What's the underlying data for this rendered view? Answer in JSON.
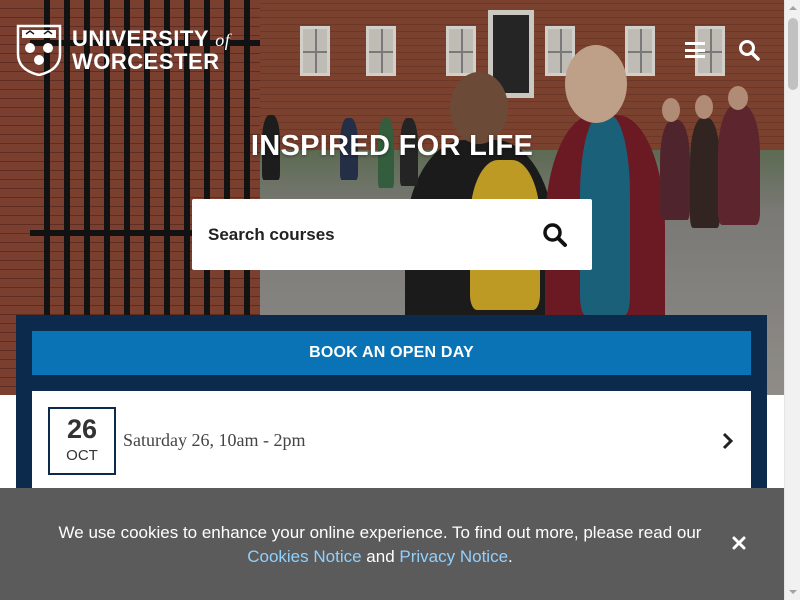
{
  "header": {
    "logo_line1": "UNIVERSITY",
    "logo_of": "of",
    "logo_line2": "WORCESTER",
    "menu_icon": "hamburger-menu-icon",
    "search_icon": "search-icon"
  },
  "hero": {
    "headline": "INSPIRED FOR LIFE",
    "search_placeholder": "Search courses"
  },
  "open_day": {
    "button_label": "BOOK AN OPEN DAY",
    "event": {
      "day": "26",
      "month": "OCT",
      "text": "Saturday 26, 10am - 2pm"
    }
  },
  "cookie": {
    "text_before": "We use cookies to enhance your online experience. To find out more, please read our",
    "cookies_link": "Cookies Notice",
    "and": "and",
    "privacy_link": "Privacy Notice",
    "period": "."
  },
  "colors": {
    "navy": "#0b2a4c",
    "blue_button": "#0a73b5",
    "cookie_bar": "#5b5b5b",
    "link": "#8fd0ff"
  }
}
